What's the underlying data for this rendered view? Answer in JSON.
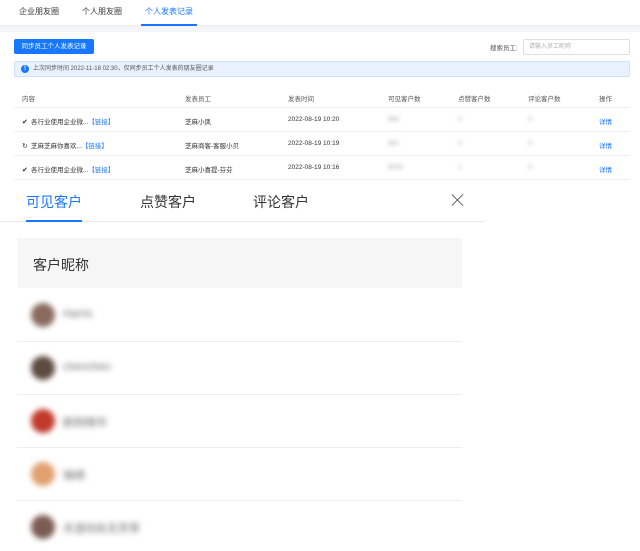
{
  "top_tabs": [
    {
      "label": "企业朋友圈"
    },
    {
      "label": "个人朋友圈"
    },
    {
      "label": "个人发表记录",
      "active": true
    }
  ],
  "toolbar": {
    "sync_button": "同步员工个人发表记录",
    "search_label": "搜索员工:",
    "search_placeholder": "请输入员工昵称"
  },
  "info_bar": {
    "icon": "info-icon",
    "text": "上次同步时间 2022-11-18 02:30，仅同步员工个人发表的朋友圈记录"
  },
  "table": {
    "columns": [
      "内容",
      "发表员工",
      "发表时间",
      "可见客户数",
      "点赞客户数",
      "评论客户数",
      "操作"
    ],
    "rows": [
      {
        "icon": "check-icon",
        "content": "各行业使用企业微...",
        "link": "【链接】",
        "employee": "芝麻小凤",
        "time": "2022-08-19 10:20",
        "visible": "666",
        "likes": "5",
        "comments": "0",
        "action": "详情"
      },
      {
        "icon": "refresh-icon",
        "content": "芝麻芝麻你喜欢...",
        "link": "【链接】",
        "employee": "芝麻商客-客服小贝",
        "time": "2022-08-19 10:19",
        "visible": "481",
        "likes": "0",
        "comments": "0",
        "action": "详情"
      },
      {
        "icon": "check-icon",
        "content": "各行业使用企业微...",
        "link": "【链接】",
        "employee": "芝麻小喜提-芬芬",
        "time": "2022-08-19 10:16",
        "visible": "6678",
        "likes": "1",
        "comments": "0",
        "action": "详情"
      }
    ]
  },
  "modal": {
    "tabs": [
      {
        "label": "可见客户",
        "active": true
      },
      {
        "label": "点赞客户"
      },
      {
        "label": "评论客户"
      }
    ],
    "close_icon": "close-icon",
    "list_header": "客户昵称",
    "customers": [
      {
        "name": "Harris",
        "avatar_color": "#8a6a5e"
      },
      {
        "name": "chenchen",
        "avatar_color": "#5d4a40"
      },
      {
        "name": "欧阳晓华",
        "avatar_color": "#c0392b"
      },
      {
        "name": "锦绣",
        "avatar_color": "#e0a070"
      },
      {
        "name": "天涯何处无芳草",
        "avatar_color": "#7a5c52"
      }
    ]
  },
  "colors": {
    "accent": "#1677ff",
    "info_bg": "#e8f1fe"
  }
}
